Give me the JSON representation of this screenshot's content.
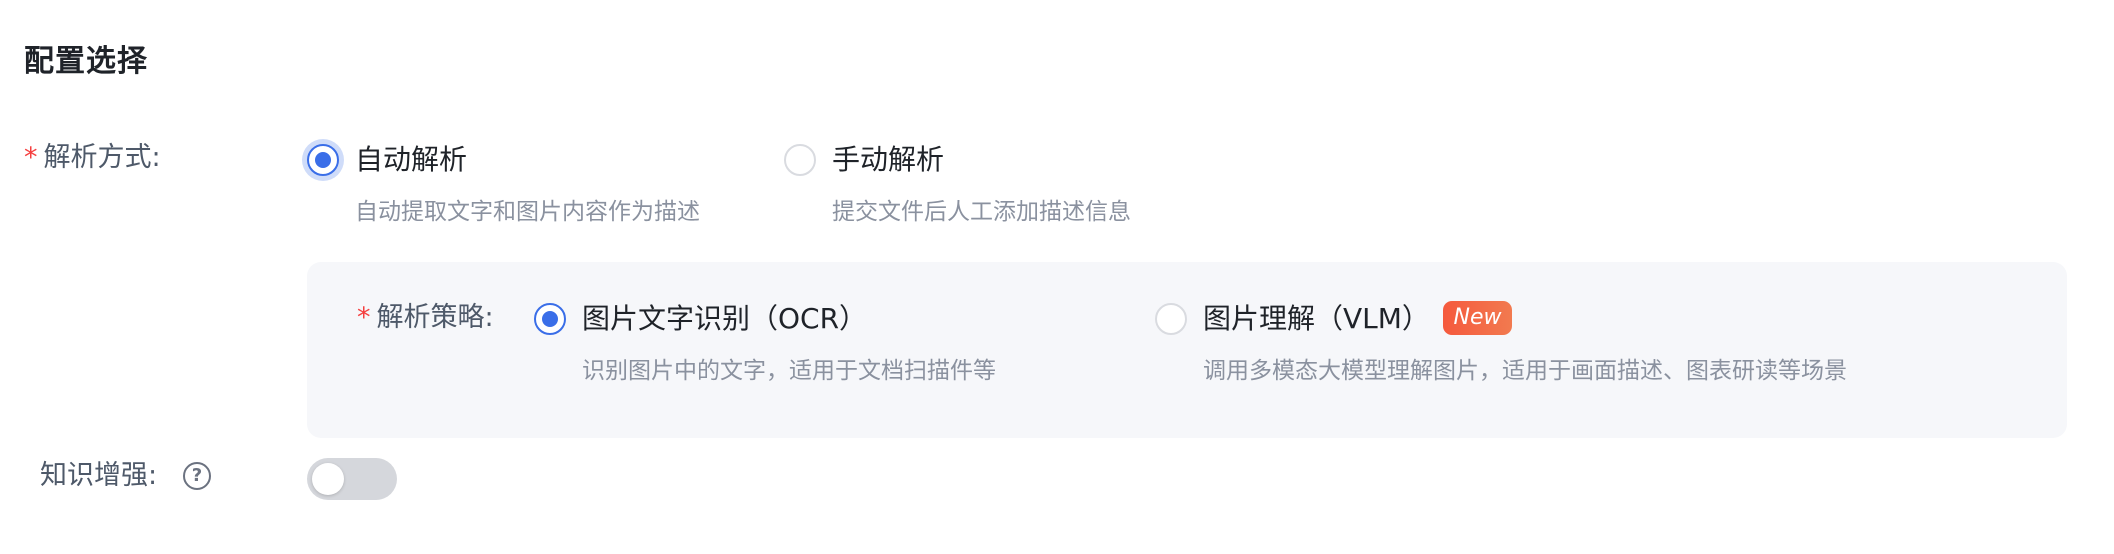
{
  "section": {
    "title": "配置选择"
  },
  "parse_mode": {
    "required_mark": "*",
    "label": "解析方式:",
    "selected": "auto",
    "options": [
      {
        "label": "自动解析",
        "description": "自动提取文字和图片内容作为描述",
        "checked": true
      },
      {
        "label": "手动解析",
        "description": "提交文件后人工添加描述信息",
        "checked": false
      }
    ]
  },
  "parse_strategy": {
    "required_mark": "*",
    "label": "解析策略:",
    "selected": "ocr",
    "options": [
      {
        "label": "图片文字识别（OCR）",
        "description": "识别图片中的文字，适用于文档扫描件等",
        "checked": true
      },
      {
        "label": "图片理解（VLM）",
        "description": "调用多模态大模型理解图片，适用于画面描述、图表研读等场景",
        "checked": false,
        "badge": "New"
      }
    ]
  },
  "knowledge_enhance": {
    "label": "知识增强:",
    "help_icon": "question-circle-icon",
    "help_glyph": "?",
    "enabled": false
  },
  "colors": {
    "accent": "#3a6ee8",
    "required": "#f53f3f",
    "badge_start": "#f5593d",
    "badge_end": "#f27a4f",
    "panel_bg": "#f6f7fa",
    "toggle_off": "#d5d7dc"
  }
}
